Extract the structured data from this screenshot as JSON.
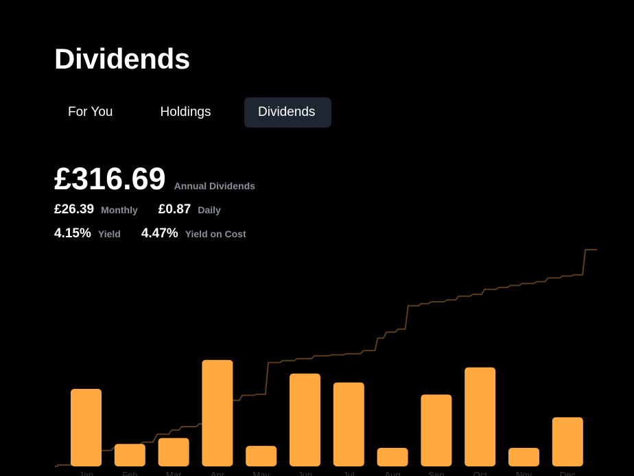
{
  "page": {
    "title": "Dividends"
  },
  "tabs": [
    {
      "label": "For You",
      "active": false
    },
    {
      "label": "Holdings",
      "active": false
    },
    {
      "label": "Dividends",
      "active": true
    }
  ],
  "summary": {
    "annual_value": "£316.69",
    "annual_label": "Annual Dividends",
    "monthly_value": "£26.39",
    "monthly_label": "Monthly",
    "daily_value": "£0.87",
    "daily_label": "Daily",
    "yield_value": "4.15%",
    "yield_label": "Yield",
    "yoc_value": "4.47%",
    "yoc_label": "Yield on Cost"
  },
  "colors": {
    "background": "#000000",
    "accent": "#ffa940",
    "cumulative_line": "#5a3d1e",
    "active_tab": "#1e2632",
    "muted_text": "#8a8f9a",
    "month_label": "#3a3a3a"
  },
  "chart_data": {
    "type": "bar",
    "categories": [
      "Jan",
      "Feb",
      "Mar",
      "Apr",
      "May",
      "Jun",
      "Jul",
      "Aug",
      "Sep",
      "Oct",
      "Nov",
      "Dec"
    ],
    "values": [
      31.4,
      9.1,
      11.5,
      43.1,
      8.3,
      37.6,
      34.0,
      7.5,
      29.1,
      40.1,
      7.5,
      19.9
    ],
    "cumulative": {
      "type": "line",
      "description_visible": false,
      "points": [
        [
          0.0,
          0.0
        ],
        [
          0.08,
          0.0
        ],
        [
          0.1,
          2.1
        ],
        [
          0.55,
          2.1
        ],
        [
          0.6,
          15.1
        ],
        [
          0.95,
          15.1
        ],
        [
          1.05,
          18.2
        ],
        [
          1.4,
          18.2
        ],
        [
          1.55,
          23.4
        ],
        [
          1.95,
          23.4
        ],
        [
          2.05,
          27.5
        ],
        [
          2.4,
          27.5
        ],
        [
          2.55,
          31.6
        ],
        [
          2.95,
          31.6
        ],
        [
          3.05,
          35.5
        ],
        [
          3.4,
          35.5
        ],
        [
          3.55,
          47.0
        ],
        [
          3.95,
          47.0
        ],
        [
          4.05,
          53.0
        ],
        [
          4.3,
          53.0
        ],
        [
          4.4,
          58.1
        ],
        [
          4.9,
          58.1
        ],
        [
          5.0,
          62.0
        ],
        [
          5.3,
          62.0
        ],
        [
          5.4,
          85.5
        ],
        [
          5.7,
          85.5
        ],
        [
          5.8,
          91.6
        ],
        [
          6.0,
          91.6
        ],
        [
          6.1,
          96.4
        ],
        [
          6.4,
          96.4
        ],
        [
          6.5,
          103.8
        ],
        [
          6.9,
          103.8
        ],
        [
          7.0,
          105.3
        ],
        [
          7.3,
          105.3
        ],
        [
          7.4,
          151.7
        ],
        [
          7.8,
          151.7
        ],
        [
          7.9,
          154.5
        ],
        [
          8.3,
          154.5
        ],
        [
          8.4,
          157.3
        ],
        [
          8.9,
          157.3
        ],
        [
          9.0,
          161.6
        ],
        [
          9.5,
          161.6
        ],
        [
          9.6,
          163.0
        ],
        [
          10.0,
          163.0
        ],
        [
          10.1,
          164.6
        ],
        [
          10.6,
          164.6
        ],
        [
          10.7,
          169.3
        ],
        [
          11.1,
          169.3
        ],
        [
          11.2,
          187.5
        ],
        [
          11.4,
          187.5
        ],
        [
          11.5,
          196.1
        ],
        [
          11.8,
          196.1
        ],
        [
          11.9,
          200.5
        ],
        [
          12.15,
          200.5
        ],
        [
          12.25,
          234.8
        ],
        [
          12.6,
          234.8
        ],
        [
          12.7,
          237.7
        ],
        [
          12.95,
          237.7
        ],
        [
          13.05,
          240.5
        ],
        [
          13.5,
          240.5
        ],
        [
          13.6,
          243.3
        ],
        [
          13.9,
          243.3
        ],
        [
          14.0,
          248.6
        ],
        [
          14.4,
          248.6
        ],
        [
          14.5,
          251.4
        ],
        [
          14.8,
          251.4
        ],
        [
          14.9,
          258.7
        ],
        [
          15.3,
          258.7
        ],
        [
          15.4,
          261.5
        ],
        [
          15.7,
          261.5
        ],
        [
          15.8,
          264.3
        ],
        [
          16.1,
          264.3
        ],
        [
          16.2,
          267.2
        ],
        [
          16.6,
          267.2
        ],
        [
          16.7,
          270.0
        ],
        [
          17.0,
          270.0
        ],
        [
          17.1,
          275.3
        ],
        [
          17.5,
          275.3
        ],
        [
          17.6,
          278.1
        ],
        [
          17.9,
          278.1
        ],
        [
          18.0,
          279.8
        ],
        [
          18.3,
          279.8
        ],
        [
          18.4,
          316.7
        ],
        [
          18.8,
          316.7
        ]
      ]
    },
    "title": "",
    "xlabel": "",
    "ylabel": "",
    "ylim": [
      0,
      50
    ],
    "grid": false,
    "legend": "none"
  }
}
